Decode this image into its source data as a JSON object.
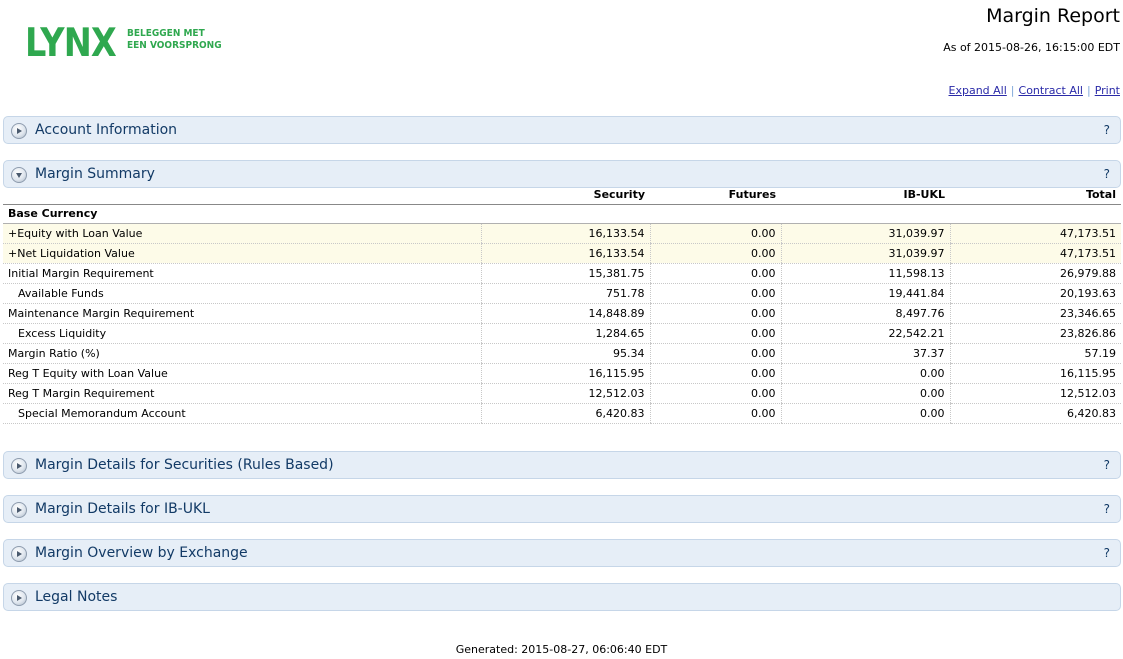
{
  "brand": {
    "logo_text": "LYNX",
    "tagline_line1": "BELEGGEN MET",
    "tagline_line2": "EEN VOORSPRONG",
    "brand_color": "#2fa84f"
  },
  "report": {
    "title": "Margin Report",
    "as_of": "As of 2015-08-26, 16:15:00 EDT"
  },
  "links": {
    "expand_all": "Expand All",
    "contract_all": "Contract All",
    "print": "Print",
    "separator": "|"
  },
  "sections": {
    "account_information": {
      "title": "Account Information",
      "help": "?",
      "icon": "expand-arrow-icon"
    },
    "margin_summary": {
      "title": "Margin Summary",
      "help": "?",
      "icon": "collapse-arrow-icon"
    },
    "margin_details_securities": {
      "title": "Margin Details for Securities (Rules Based)",
      "help": "?"
    },
    "margin_details_ibukl": {
      "title": "Margin Details for IB-UKL",
      "help": "?"
    },
    "margin_overview_exchange": {
      "title": "Margin Overview by Exchange",
      "help": "?"
    },
    "legal_notes": {
      "title": "Legal Notes"
    }
  },
  "table": {
    "headers": [
      "",
      "Security",
      "Futures",
      "IB-UKL",
      "Total"
    ],
    "group_label": "Base Currency",
    "rows": [
      {
        "label": "+Equity with Loan Value",
        "values": [
          "16,133.54",
          "0.00",
          "31,039.97",
          "47,173.51"
        ]
      },
      {
        "label": "+Net Liquidation Value",
        "values": [
          "16,133.54",
          "0.00",
          "31,039.97",
          "47,173.51"
        ]
      },
      {
        "label": "Initial Margin Requirement",
        "values": [
          "15,381.75",
          "0.00",
          "11,598.13",
          "26,979.88"
        ]
      },
      {
        "label": "Available Funds",
        "values": [
          "751.78",
          "0.00",
          "19,441.84",
          "20,193.63"
        ]
      },
      {
        "label": "Maintenance Margin Requirement",
        "values": [
          "14,848.89",
          "0.00",
          "8,497.76",
          "23,346.65"
        ]
      },
      {
        "label": "Excess Liquidity",
        "values": [
          "1,284.65",
          "0.00",
          "22,542.21",
          "23,826.86"
        ]
      },
      {
        "label": "Margin Ratio (%)",
        "values": [
          "95.34",
          "0.00",
          "37.37",
          "57.19"
        ]
      },
      {
        "label": "Reg T Equity with Loan Value",
        "values": [
          "16,115.95",
          "0.00",
          "0.00",
          "16,115.95"
        ]
      },
      {
        "label": "Reg T Margin Requirement",
        "values": [
          "12,512.03",
          "0.00",
          "0.00",
          "12,512.03"
        ]
      },
      {
        "label": "Special Memorandum Account",
        "values": [
          "6,420.83",
          "0.00",
          "0.00",
          "6,420.83"
        ]
      }
    ]
  },
  "footer": {
    "generated": "Generated: 2015-08-27, 06:06:40 EDT"
  }
}
